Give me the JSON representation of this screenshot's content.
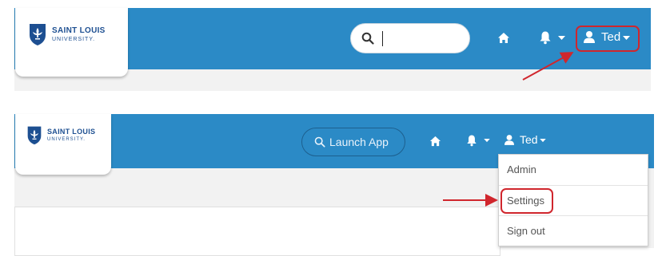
{
  "colors": {
    "navbar": "#2b8ac6",
    "highlight": "#d0262d",
    "logo_blue": "#1d4f91"
  },
  "panel_before": {
    "logo": {
      "line1": "SAINT LOUIS",
      "line2": "UNIVERSITY.",
      "icon": "fleur-de-lis-shield-icon"
    },
    "search": {
      "value": "",
      "icon": "search-icon"
    },
    "nav": {
      "home_icon": "home-icon",
      "notifications_icon": "bell-icon",
      "user_icon": "user-icon",
      "user_name": "Ted"
    }
  },
  "panel_after": {
    "logo": {
      "line1": "SAINT LOUIS",
      "line2": "UNIVERSITY.",
      "icon": "fleur-de-lis-shield-icon"
    },
    "search": {
      "placeholder": "Launch App",
      "icon": "search-icon"
    },
    "nav": {
      "home_icon": "home-icon",
      "notifications_icon": "bell-icon",
      "user_icon": "user-icon",
      "user_name": "Ted"
    },
    "user_menu": {
      "items": [
        {
          "label": "Admin"
        },
        {
          "label": "Settings",
          "highlighted": true
        },
        {
          "label": "Sign out"
        }
      ]
    }
  }
}
